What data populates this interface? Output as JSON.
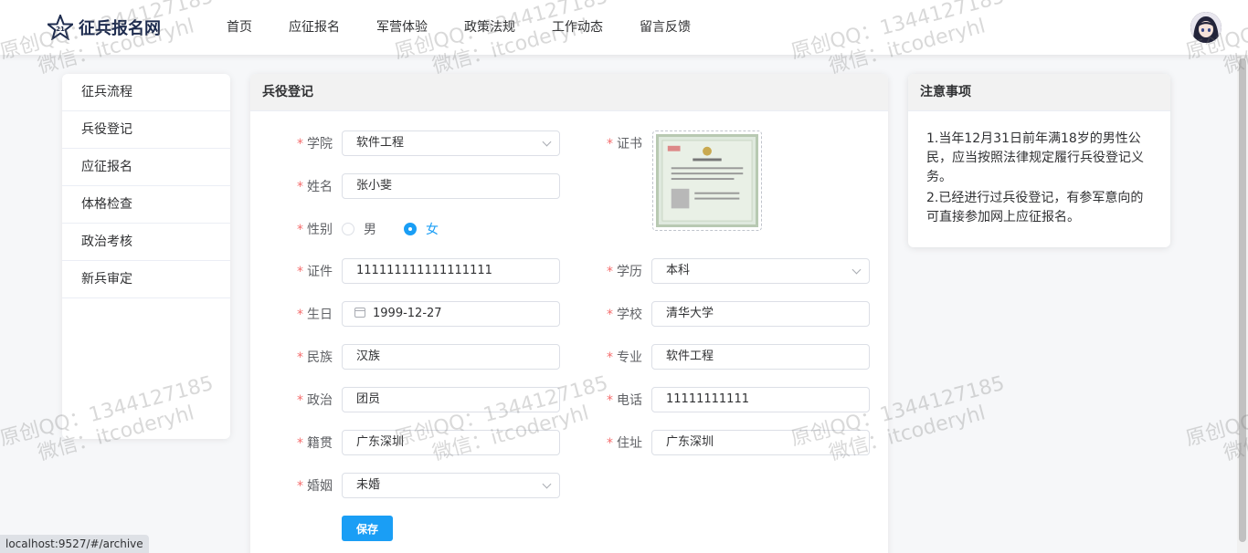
{
  "header": {
    "logo_text": "征兵报名网",
    "nav": [
      "首页",
      "应征报名",
      "军营体验",
      "政策法规",
      "工作动态",
      "留言反馈"
    ]
  },
  "sidebar": {
    "items": [
      "征兵流程",
      "兵役登记",
      "应征报名",
      "体格检查",
      "政治考核",
      "新兵审定"
    ]
  },
  "form": {
    "title": "兵役登记",
    "required_mark": "*",
    "labels": {
      "college": "学院",
      "name": "姓名",
      "gender": "性别",
      "id": "证件",
      "birthday": "生日",
      "ethnicity": "民族",
      "politics": "政治",
      "hometown": "籍贯",
      "marriage": "婚姻",
      "certificate": "证书",
      "education": "学历",
      "school": "学校",
      "major": "专业",
      "phone": "电话",
      "address": "住址"
    },
    "values": {
      "college": "软件工程",
      "name": "张小斐",
      "gender_options": [
        "男",
        "女"
      ],
      "gender_selected": "女",
      "id": "111111111111111111",
      "birthday": "1999-12-27",
      "ethnicity": "汉族",
      "politics": "团员",
      "hometown": "广东深圳",
      "marriage": "未婚",
      "education": "本科",
      "school": "清华大学",
      "major": "软件工程",
      "phone": "11111111111",
      "address": "广东深圳"
    },
    "save_label": "保存"
  },
  "notice": {
    "title": "注意事项",
    "lines": [
      "1.当年12月31日前年满18岁的男性公民，应当按照法律规定履行兵役登记义务。",
      "2.已经进行过兵役登记，有参军意向的可直接参加网上应征报名。"
    ]
  },
  "status_url": "localhost:9527/#/archive",
  "watermark": {
    "line1": "原创QQ：1344127185",
    "line2": "微信：itcoderyhl"
  },
  "colors": {
    "accent": "#1a9ef5",
    "required": "#f56c6c"
  }
}
